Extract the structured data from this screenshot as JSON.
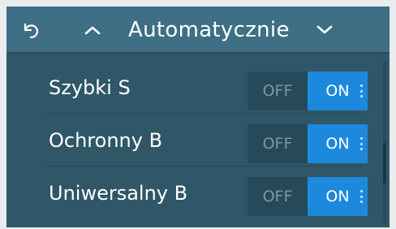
{
  "header": {
    "title": "Automatycznie",
    "back_icon": "back-icon",
    "up_icon": "chevron-up-icon",
    "down_icon": "chevron-down-icon"
  },
  "programs": [
    {
      "label": "Szybki S",
      "off": "OFF",
      "on": "ON",
      "state": "on"
    },
    {
      "label": "Ochronny B",
      "off": "OFF",
      "on": "ON",
      "state": "on"
    },
    {
      "label": "Uniwersalny B",
      "off": "OFF",
      "on": "ON",
      "state": "on"
    }
  ],
  "colors": {
    "background": "#2f5768",
    "header": "#3e6f84",
    "toggle_on": "#1d89dc",
    "toggle_off": "#274a5a"
  }
}
